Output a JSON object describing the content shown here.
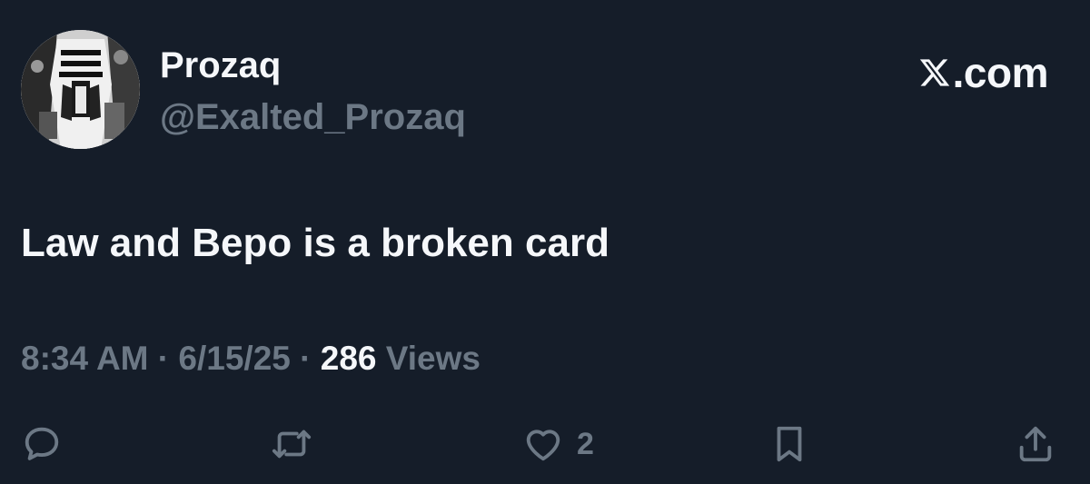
{
  "author": {
    "display_name": "Prozaq",
    "handle": "@Exalted_Prozaq"
  },
  "brand": {
    "label": ".com",
    "icon": "x-logo-icon"
  },
  "post": {
    "text": "Law and Bepo is a broken card"
  },
  "meta": {
    "time": "8:34 AM",
    "sep1": " · ",
    "date": "6/15/25",
    "sep2": " · ",
    "views_count": "286",
    "views_label": " Views"
  },
  "actions": {
    "reply": {
      "icon": "reply-icon"
    },
    "repost": {
      "icon": "repost-icon"
    },
    "like": {
      "icon": "heart-icon",
      "count": "2"
    },
    "bookmark": {
      "icon": "bookmark-icon"
    },
    "share": {
      "icon": "share-icon"
    }
  },
  "colors": {
    "background": "#151d29",
    "primary_text": "#f5f7fa",
    "secondary_text": "#6c7885"
  }
}
